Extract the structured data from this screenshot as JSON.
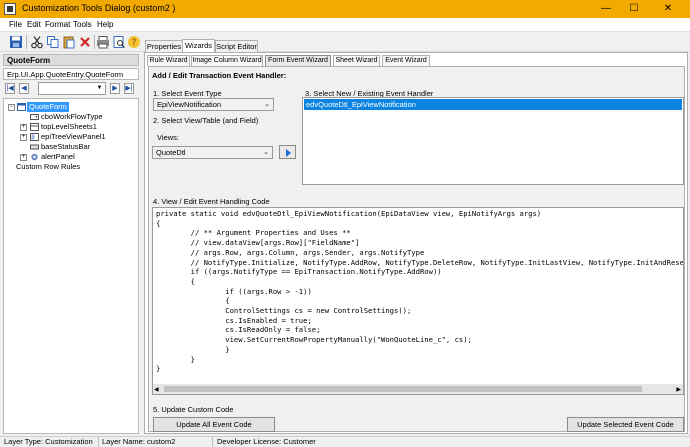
{
  "window": {
    "title": "Customization Tools Dialog  (custom2 )",
    "minimize_glyph": "—",
    "maximize_glyph": "☐",
    "close_glyph": "✕"
  },
  "menu": {
    "items": [
      "File",
      "Edit",
      "Format",
      "Tools",
      "Help"
    ]
  },
  "left": {
    "header": "QuoteForm",
    "path": "Erp.UI.App.QuoteEntry.QuoteForm",
    "tree": {
      "root": "QuoteForm",
      "children": [
        "cboWorkFlowType",
        "topLevelSheets1",
        "epiTreeViewPanel1",
        "baseStatusBar",
        "alertPanel"
      ],
      "custom": "Custom Row Rules"
    }
  },
  "tabs": {
    "main": [
      "Properties",
      "Wizards",
      "Script Editor"
    ],
    "sub": [
      "Rule Wizard",
      "Image Column Wizard",
      "Form Event Wizard",
      "Sheet Wizard",
      "Event Wizard"
    ]
  },
  "wizard": {
    "heading": "Add / Edit Transaction Event Handler:",
    "step1_label": "1. Select Event Type",
    "step1_value": "EpiViewNotification",
    "step2_label": "2. Select View/Table (and Field)",
    "views_label": "Views:",
    "views_value": "QuoteDtl",
    "step3_label": "3. Select New / Existing Event Handler",
    "handler_selected": "edvQuoteDtl_EpiViewNotification",
    "step4_label": "4. View / Edit Event Handling Code",
    "code": "private static void edvQuoteDtl_EpiViewNotification(EpiDataView view, EpiNotifyArgs args)\n{\n        // ** Argument Properties and Uses **\n        // view.dataView[args.Row][\"FieldName\"]\n        // args.Row, args.Column, args.Sender, args.NotifyType\n        // NotifyType.Initialize, NotifyType.AddRow, NotifyType.DeleteRow, NotifyType.InitLastView, NotifyType.InitAndResetTreeNodes\n        if ((args.NotifyType == EpiTransaction.NotifyType.AddRow))\n        {\n                if ((args.Row > -1))\n                {\n                ControlSettings cs = new ControlSettings();\n                cs.IsEnabled = true;\n                cs.IsReadOnly = false;\n                view.SetCurrentRowPropertyManually(\"WonQuoteLine_c\", cs);\n                }\n        }\n}",
    "step5_label": "5. Update Custom Code",
    "update_all_label": "Update All Event Code",
    "update_selected_label": "Update Selected Event Code"
  },
  "status": {
    "layer_type": "Layer Type:  Customization",
    "layer_name": "Layer Name:  custom2",
    "developer_license": "Developer License:  Customer"
  },
  "colors": {
    "titlebar": "#f2a900",
    "selection": "#0a84e0",
    "tree_selection": "#3399ff"
  }
}
